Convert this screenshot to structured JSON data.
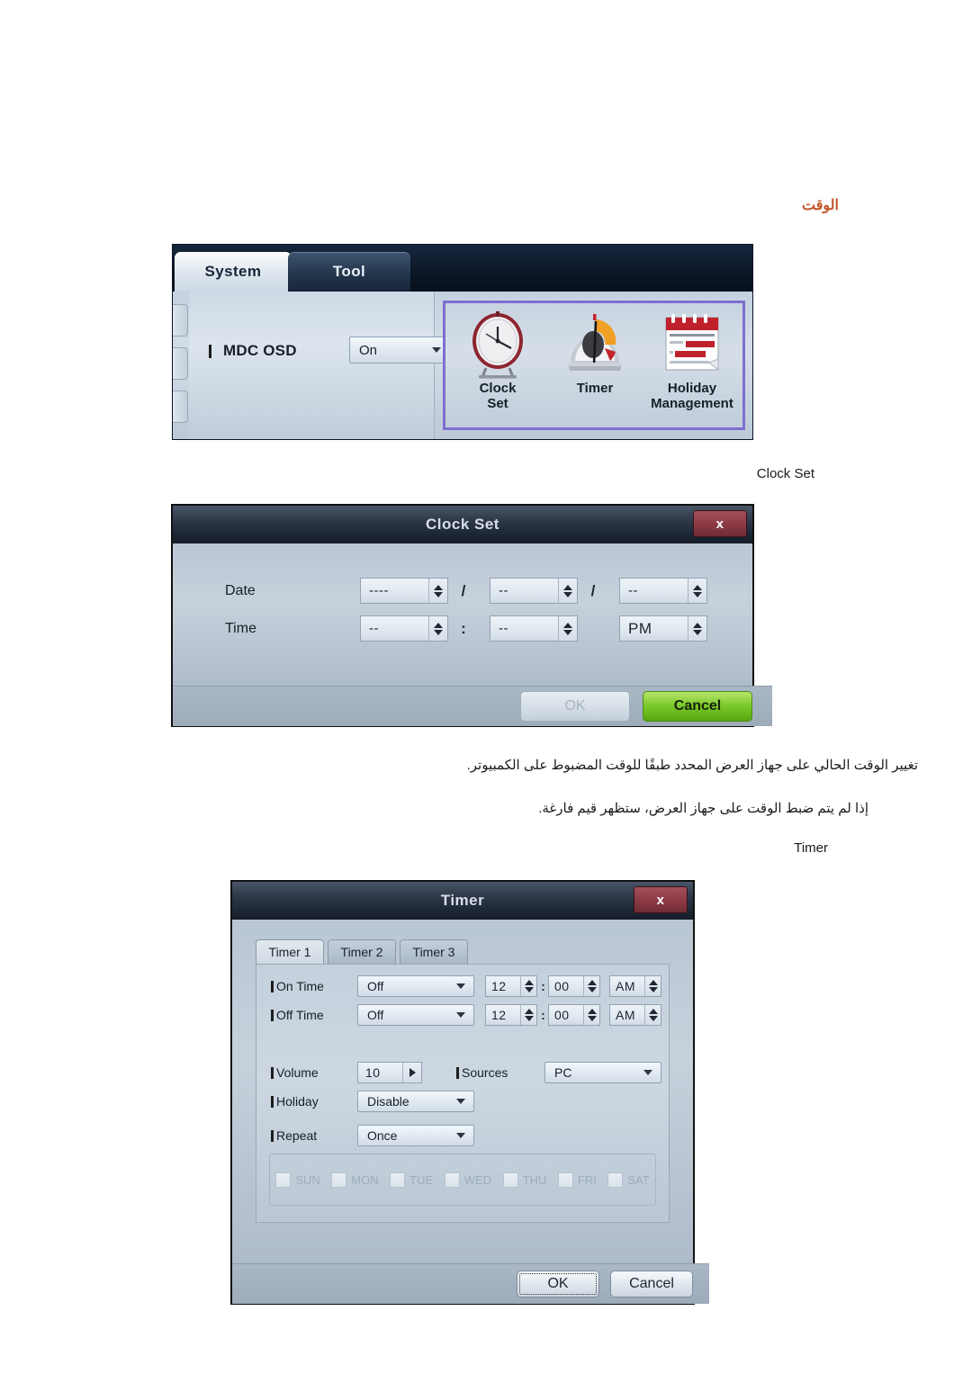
{
  "page": {
    "heading_ar": "الوقت",
    "caption_clock_set": "Clock Set",
    "caption_timer": "Timer",
    "paragraph_1_ar": "تغيير الوقت الحالي على جهاز العرض المحدد طبقًا للوقت المضبوط على الكمبيوتر.",
    "paragraph_2_ar": "إذا لم يتم ضبط الوقت على جهاز العرض، ستظهر قيم فارغة."
  },
  "colors": {
    "heading": "#c2562a",
    "selection_border": "#7d6fd0",
    "dialog_header": "#2d3747",
    "close_button": "#8d3b46",
    "cancel_green": "#7bc92b"
  },
  "system_screen": {
    "tabs": [
      {
        "label": "System",
        "active": true
      },
      {
        "label": "Tool",
        "active": false
      }
    ],
    "setting": {
      "label": "MDC OSD",
      "value": "On"
    },
    "icons": [
      {
        "label_line1": "Clock",
        "label_line2": "Set",
        "icon": "alarm-clock-icon"
      },
      {
        "label_line1": "Timer",
        "label_line2": "",
        "icon": "timer-dial-icon"
      },
      {
        "label_line1": "Holiday",
        "label_line2": "Management",
        "icon": "calendar-icon"
      }
    ]
  },
  "clock_set_dialog": {
    "title": "Clock Set",
    "close_label": "x",
    "rows": [
      {
        "label": "Date",
        "fields": [
          {
            "value": "----"
          },
          {
            "value": "--"
          },
          {
            "value": "--"
          }
        ],
        "separators": [
          "/",
          "/"
        ]
      },
      {
        "label": "Time",
        "fields": [
          {
            "value": "--"
          },
          {
            "value": "--"
          },
          {
            "value": "PM"
          }
        ],
        "separators": [
          ":",
          ""
        ]
      }
    ],
    "buttons": [
      {
        "label": "OK",
        "state": "disabled"
      },
      {
        "label": "Cancel",
        "state": "highlight"
      }
    ]
  },
  "timer_dialog": {
    "title": "Timer",
    "close_label": "x",
    "tabs": [
      {
        "label": "Timer 1",
        "active": true
      },
      {
        "label": "Timer 2",
        "active": false
      },
      {
        "label": "Timer 3",
        "active": false
      }
    ],
    "on_time": {
      "label": "On Time",
      "mode": "Off",
      "hour": "12",
      "minute": "00",
      "meridiem": "AM"
    },
    "off_time": {
      "label": "Off Time",
      "mode": "Off",
      "hour": "12",
      "minute": "00",
      "meridiem": "AM"
    },
    "volume": {
      "label": "Volume",
      "value": "10"
    },
    "sources": {
      "label": "Sources",
      "value": "PC"
    },
    "holiday": {
      "label": "Holiday",
      "value": "Disable"
    },
    "repeat": {
      "label": "Repeat",
      "value": "Once"
    },
    "days": [
      {
        "label": "SUN",
        "checked": false
      },
      {
        "label": "MON",
        "checked": false
      },
      {
        "label": "TUE",
        "checked": false
      },
      {
        "label": "WED",
        "checked": false
      },
      {
        "label": "THU",
        "checked": false
      },
      {
        "label": "FRI",
        "checked": false
      },
      {
        "label": "SAT",
        "checked": false
      }
    ],
    "buttons": [
      {
        "label": "OK",
        "state": "focused"
      },
      {
        "label": "Cancel",
        "state": "normal"
      }
    ]
  }
}
